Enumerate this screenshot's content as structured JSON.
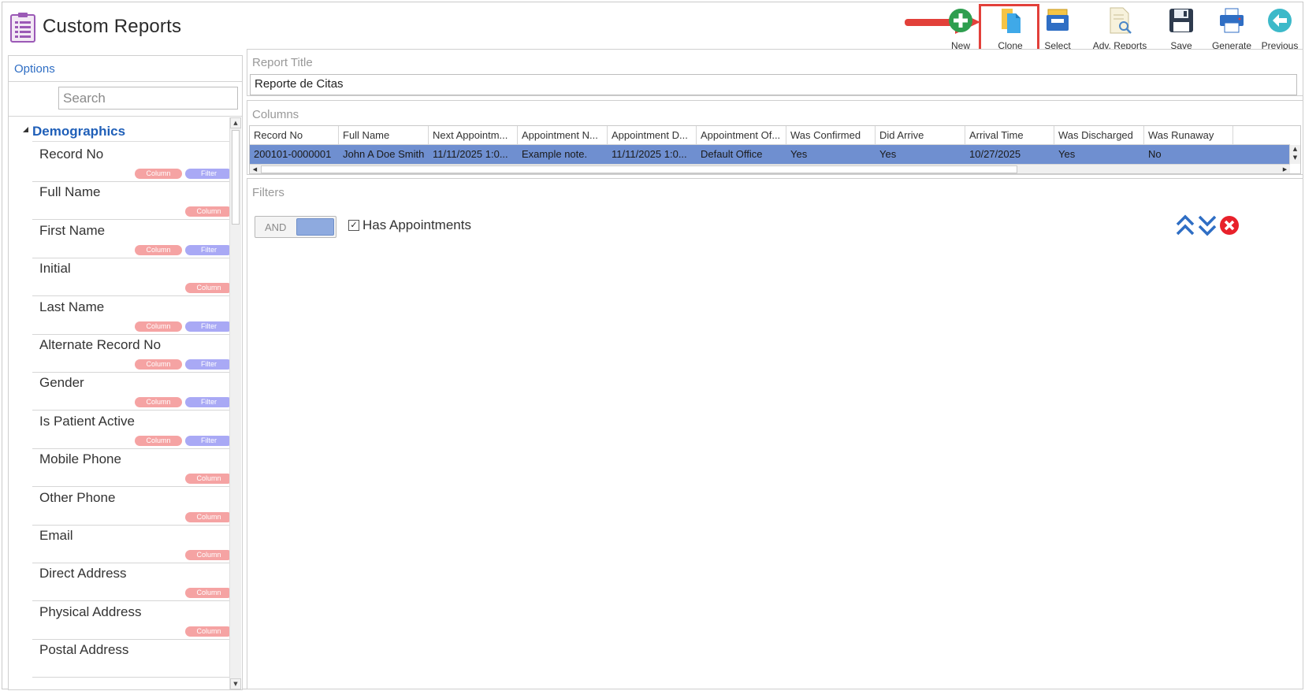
{
  "app": {
    "title": "Custom Reports",
    "title_icon": "report-list-icon"
  },
  "toolbar": {
    "items": [
      {
        "label": "New",
        "icon": "new-plus-icon"
      },
      {
        "label": "Clone",
        "icon": "clone-icon",
        "highlighted": true
      },
      {
        "label": "Select",
        "icon": "select-tray-icon"
      },
      {
        "label": "Adv. Reports",
        "icon": "adv-reports-icon"
      },
      {
        "label": "Save",
        "icon": "save-disk-icon"
      },
      {
        "label": "Generate",
        "icon": "printer-icon"
      },
      {
        "label": "Previous",
        "icon": "back-arrow-icon"
      }
    ],
    "highlight_color": "#e2403a"
  },
  "options": {
    "title": "Options",
    "search_placeholder": "Search",
    "group": "Demographics",
    "pill_column_label": "Column",
    "pill_filter_label": "Filter",
    "fields": [
      {
        "name": "Record No",
        "column": true,
        "filter": true
      },
      {
        "name": "Full Name",
        "column": true,
        "filter": false
      },
      {
        "name": "First Name",
        "column": true,
        "filter": true
      },
      {
        "name": "Initial",
        "column": true,
        "filter": false
      },
      {
        "name": "Last Name",
        "column": true,
        "filter": true
      },
      {
        "name": "Alternate Record No",
        "column": true,
        "filter": true
      },
      {
        "name": "Gender",
        "column": true,
        "filter": true
      },
      {
        "name": "Is Patient Active",
        "column": true,
        "filter": true
      },
      {
        "name": "Mobile Phone",
        "column": true,
        "filter": false
      },
      {
        "name": "Other Phone",
        "column": true,
        "filter": false
      },
      {
        "name": "Email",
        "column": true,
        "filter": false
      },
      {
        "name": "Direct Address",
        "column": true,
        "filter": false
      },
      {
        "name": "Physical Address",
        "column": true,
        "filter": false
      },
      {
        "name": "Postal Address",
        "column": false,
        "filter": false
      }
    ]
  },
  "report": {
    "title_label": "Report Title",
    "title_value": "Reporte de Citas"
  },
  "columns": {
    "label": "Columns",
    "headers": [
      "Record No",
      "Full Name",
      "Next Appointm...",
      "Appointment N...",
      "Appointment D...",
      "Appointment Of...",
      "Was Confirmed",
      "Did Arrive",
      "Arrival Time",
      "Was Discharged",
      "Was Runaway"
    ],
    "row": [
      "200101-0000001",
      "John A Doe Smith",
      "11/11/2025 1:0...",
      "Example note.",
      "11/11/2025 1:0...",
      "Default Office",
      "Yes",
      "Yes",
      "10/27/2025",
      "Yes",
      "No"
    ],
    "selected_row_color": "#6f8fd0"
  },
  "filters": {
    "label": "Filters",
    "toggle_label": "AND",
    "items": [
      {
        "label": "Has Appointments",
        "checked": true
      }
    ]
  }
}
